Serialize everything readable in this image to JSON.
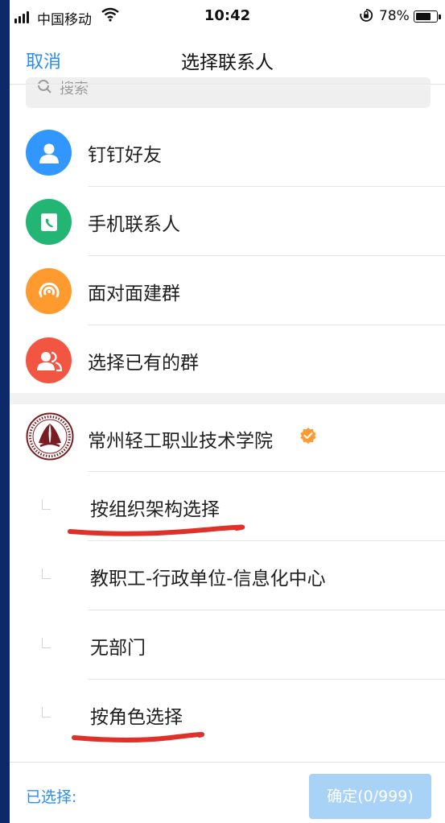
{
  "status_bar": {
    "carrier": "中国移动",
    "time": "10:42",
    "battery_percent": "78%",
    "battery_level": 0.78
  },
  "nav": {
    "cancel": "取消",
    "title": "选择联系人"
  },
  "search": {
    "placeholder": "搜索"
  },
  "sources": [
    {
      "label": "钉钉好友",
      "icon": "person-icon",
      "color": "#3296ff"
    },
    {
      "label": "手机联系人",
      "icon": "phone-contact-icon",
      "color": "#22b573"
    },
    {
      "label": "面对面建群",
      "icon": "radar-icon",
      "color": "#ff9a2e"
    },
    {
      "label": "选择已有的群",
      "icon": "group-icon",
      "color": "#f25643"
    }
  ],
  "organization": {
    "name": "常州轻工职业技术学院",
    "verified_icon": "verified-badge-icon",
    "badge_color": "#ff9a2e",
    "options": [
      {
        "label": "按组织架构选择"
      },
      {
        "label": "教职工-行政单位-信息化中心"
      },
      {
        "label": "无部门"
      },
      {
        "label": "按角色选择"
      }
    ]
  },
  "annotation_color": "#e0302a",
  "bottom_bar": {
    "selected_label": "已选择:",
    "confirm_label": "确定(0/999)"
  }
}
